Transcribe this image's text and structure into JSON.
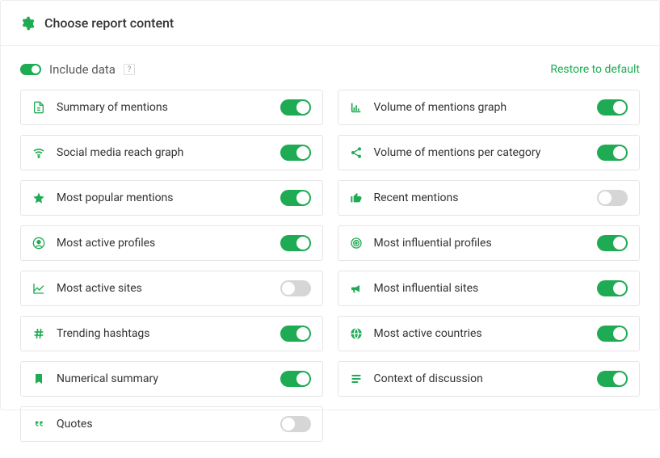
{
  "header": {
    "title": "Choose report content"
  },
  "subheader": {
    "include_data_label": "Include data",
    "include_data_on": true,
    "help": "?",
    "restore_label": "Restore to default"
  },
  "columns": {
    "left": [
      {
        "key": "summary",
        "icon": "document",
        "label": "Summary of mentions",
        "on": true
      },
      {
        "key": "reach-graph",
        "icon": "wifi",
        "label": "Social media reach graph",
        "on": true
      },
      {
        "key": "popular-mentions",
        "icon": "star",
        "label": "Most popular mentions",
        "on": true
      },
      {
        "key": "active-profiles",
        "icon": "user-circle",
        "label": "Most active profiles",
        "on": true
      },
      {
        "key": "active-sites",
        "icon": "line-chart",
        "label": "Most active sites",
        "on": false
      },
      {
        "key": "hashtags",
        "icon": "hashtag",
        "label": "Trending hashtags",
        "on": true
      },
      {
        "key": "numerical",
        "icon": "bookmark",
        "label": "Numerical summary",
        "on": true
      },
      {
        "key": "quotes",
        "icon": "quote",
        "label": "Quotes",
        "on": false
      }
    ],
    "right": [
      {
        "key": "volume-graph",
        "icon": "bar-chart",
        "label": "Volume of mentions graph",
        "on": true
      },
      {
        "key": "volume-category",
        "icon": "share",
        "label": "Volume of mentions per category",
        "on": true
      },
      {
        "key": "recent-mentions",
        "icon": "thumbs-up",
        "label": "Recent mentions",
        "on": false
      },
      {
        "key": "influential-profiles",
        "icon": "target",
        "label": "Most influential profiles",
        "on": true
      },
      {
        "key": "influential-sites",
        "icon": "bullhorn",
        "label": "Most influential sites",
        "on": true
      },
      {
        "key": "countries",
        "icon": "globe",
        "label": "Most active countries",
        "on": true
      },
      {
        "key": "context",
        "icon": "list",
        "label": "Context of discussion",
        "on": true
      }
    ]
  },
  "colors": {
    "accent": "#1fab54",
    "border": "#e5e5e5"
  }
}
